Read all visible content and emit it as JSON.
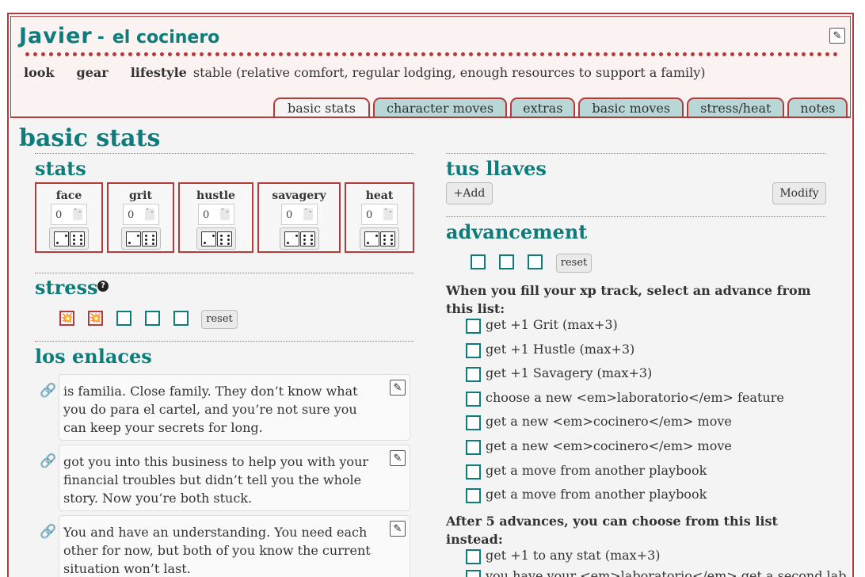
{
  "character": {
    "name": "Javier",
    "separator": "-",
    "playbook": "el cocinero"
  },
  "meta": {
    "look_label": "look",
    "gear_label": "gear",
    "lifestyle_label": "lifestyle",
    "lifestyle_value": "stable (relative comfort, regular lodging, enough resources to support a family)"
  },
  "tabs": [
    {
      "label": "basic stats",
      "active": true
    },
    {
      "label": "character moves"
    },
    {
      "label": "extras"
    },
    {
      "label": "basic moves"
    },
    {
      "label": "stress/heat"
    },
    {
      "label": "notes"
    }
  ],
  "page_title": "basic stats",
  "stats": {
    "title": "stats",
    "items": [
      {
        "label": "face",
        "value": "0"
      },
      {
        "label": "grit",
        "value": "0"
      },
      {
        "label": "hustle",
        "value": "0"
      },
      {
        "label": "savagery",
        "value": "0"
      },
      {
        "label": "heat",
        "value": "0"
      }
    ]
  },
  "stress": {
    "title": "stress",
    "help": "?",
    "boxes": [
      true,
      true,
      false,
      false,
      false
    ],
    "reset_label": "reset",
    "hit_glyph": "💥"
  },
  "enlaces": {
    "title": "los enlaces",
    "items": [
      "is familia. Close family. They don’t know what you do para el cartel, and you’re not sure you can keep your secrets for long.",
      "got you into this business to help you with your financial troubles but didn’t tell you the whole story. Now you’re both stuck.",
      "You and have an understanding. You need each other for now, but both of you know the current situation won’t last."
    ]
  },
  "llaves": {
    "title": "tus llaves",
    "add_label": "+Add",
    "modify_label": "Modify"
  },
  "advancement": {
    "title": "advancement",
    "xp_boxes": [
      false,
      false,
      false
    ],
    "reset_label": "reset",
    "list_title": "When you fill your xp track, select an advance from this list:",
    "options": [
      "get +1 Grit (max+3)",
      "get +1 Hustle (max+3)",
      "get +1 Savagery (max+3)",
      "choose a new <em>laboratorio</em> feature",
      "get a new <em>cocinero</em> move",
      "get a new <em>cocinero</em> move",
      "get a move from another playbook",
      "get a move from another playbook"
    ],
    "after_title": "After 5 advances, you can choose from this list instead:",
    "after_options": [
      "get +1 to any stat (max+3)",
      "you have your <em>laboratorio</em> get a second lab"
    ]
  },
  "icons": {
    "edit": "pencil-icon",
    "link": "link-icon",
    "help": "question-icon"
  },
  "colors": {
    "accent": "#0e7c7b",
    "border": "#b53a3a",
    "tab_bg": "#b9d7d6"
  }
}
